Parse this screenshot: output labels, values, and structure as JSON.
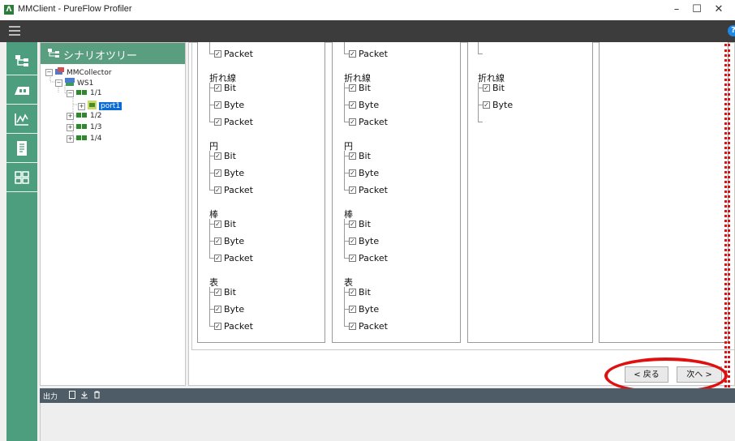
{
  "window": {
    "logo_text": "Λ",
    "title": "MMClient - PureFlow Profiler",
    "minimize": "–",
    "maximize": "☐",
    "close": "✕"
  },
  "toolbar": {
    "help": "?"
  },
  "sidebar": {
    "items": [
      {
        "icon": "scenario-tree-icon"
      },
      {
        "icon": "device-icon"
      },
      {
        "icon": "chart-icon"
      },
      {
        "icon": "report-icon"
      },
      {
        "icon": "layout-icon"
      }
    ]
  },
  "tree": {
    "header": "シナリオツリー",
    "nodes": [
      {
        "label": "MMCollector",
        "level": 0
      },
      {
        "label": "WS1",
        "level": 1
      },
      {
        "label": "1/1",
        "level": 2
      },
      {
        "label": "port1",
        "level": 3,
        "selected": true
      },
      {
        "label": "1/2",
        "level": 2
      },
      {
        "label": "1/3",
        "level": 2
      },
      {
        "label": "1/4",
        "level": 2
      }
    ]
  },
  "columns": [
    {
      "top_item": "Packet",
      "groups": [
        {
          "label": "折れ線",
          "items": [
            "Bit",
            "Byte",
            "Packet"
          ]
        },
        {
          "label": "円",
          "items": [
            "Bit",
            "Byte",
            "Packet"
          ]
        },
        {
          "label": "棒",
          "items": [
            "Bit",
            "Byte",
            "Packet"
          ]
        },
        {
          "label": "表",
          "items": [
            "Bit",
            "Byte",
            "Packet"
          ]
        }
      ]
    },
    {
      "top_item": "Packet",
      "groups": [
        {
          "label": "折れ線",
          "items": [
            "Bit",
            "Byte",
            "Packet"
          ]
        },
        {
          "label": "円",
          "items": [
            "Bit",
            "Byte",
            "Packet"
          ]
        },
        {
          "label": "棒",
          "items": [
            "Bit",
            "Byte",
            "Packet"
          ]
        },
        {
          "label": "表",
          "items": [
            "Bit",
            "Byte",
            "Packet"
          ]
        }
      ]
    },
    {
      "groups": [
        {
          "label": "折れ線",
          "items": [
            "Bit",
            "Byte"
          ]
        }
      ]
    }
  ],
  "check_mark": "✓",
  "nav": {
    "back": "< 戻る",
    "next": "次へ >"
  },
  "output": {
    "label": "出力"
  },
  "colors": {
    "accent": "#4d9e7e",
    "annotation": "#e01010",
    "selection": "#0a6ad6"
  }
}
